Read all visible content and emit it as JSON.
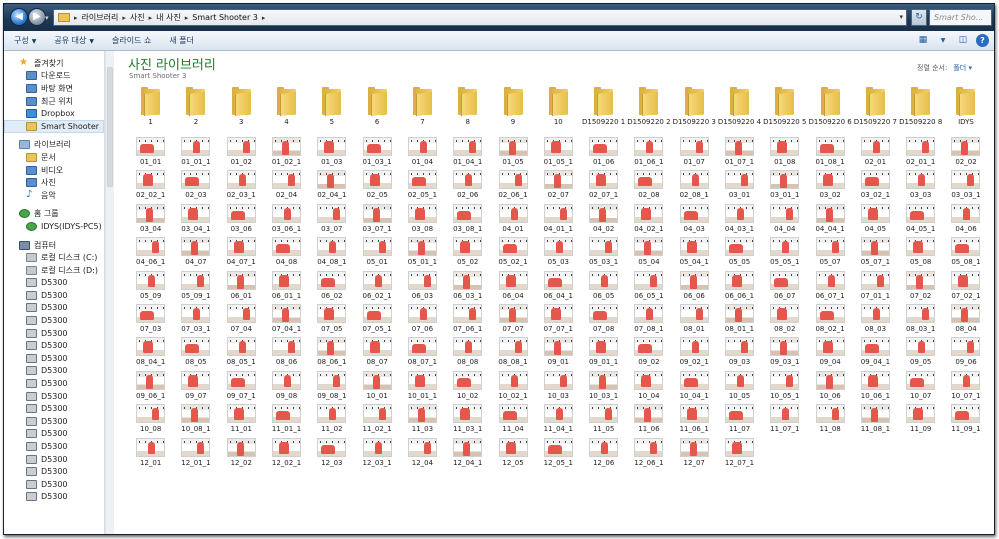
{
  "window": {
    "breadcrumb": [
      "라이브러리",
      "사진",
      "내 사진",
      "Smart Shooter 3"
    ],
    "search_placeholder": "Smart Sho..."
  },
  "toolbar": {
    "items": [
      "구성",
      "공유 대상",
      "슬라이드 쇼",
      "새 폴더"
    ]
  },
  "sidebar": {
    "groups": [
      {
        "head": "즐겨찾기",
        "icon": "star-icon",
        "items": [
          {
            "label": "다운로드",
            "icon": "download-folder-icon"
          },
          {
            "label": "바탕 화면",
            "icon": "desktop-icon"
          },
          {
            "label": "최근 위치",
            "icon": "recent-places-icon"
          },
          {
            "label": "Dropbox",
            "icon": "dropbox-icon"
          },
          {
            "label": "Smart Shooter",
            "icon": "folder-icon",
            "selected": true
          }
        ]
      },
      {
        "head": "라이브러리",
        "icon": "library-icon",
        "items": [
          {
            "label": "문서",
            "icon": "documents-icon"
          },
          {
            "label": "비디오",
            "icon": "video-icon"
          },
          {
            "label": "사진",
            "icon": "pictures-icon"
          },
          {
            "label": "음악",
            "icon": "music-icon"
          }
        ]
      },
      {
        "head": "홈 그룹",
        "icon": "homegroup-icon",
        "items": [
          {
            "label": "IDYS(IDYS-PC5)",
            "icon": "user-icon"
          }
        ]
      },
      {
        "head": "컴퓨터",
        "icon": "computer-icon",
        "items": [
          {
            "label": "로컬 디스크 (C:)",
            "icon": "drive-icon"
          },
          {
            "label": "로컬 디스크 (D:)",
            "icon": "drive-icon"
          },
          {
            "label": "D5300",
            "icon": "camera-device-icon"
          },
          {
            "label": "D5300",
            "icon": "camera-device-icon"
          },
          {
            "label": "D5300",
            "icon": "camera-device-icon"
          },
          {
            "label": "D5300",
            "icon": "camera-device-icon"
          },
          {
            "label": "D5300",
            "icon": "camera-device-icon"
          },
          {
            "label": "D5300",
            "icon": "camera-device-icon"
          },
          {
            "label": "D5300",
            "icon": "camera-device-icon"
          },
          {
            "label": "D5300",
            "icon": "camera-device-icon"
          },
          {
            "label": "D5300",
            "icon": "camera-device-icon"
          },
          {
            "label": "D5300",
            "icon": "camera-device-icon"
          },
          {
            "label": "D5300",
            "icon": "camera-device-icon"
          },
          {
            "label": "D5300",
            "icon": "camera-device-icon"
          },
          {
            "label": "D5300",
            "icon": "camera-device-icon"
          },
          {
            "label": "D5300",
            "icon": "camera-device-icon"
          },
          {
            "label": "D5300",
            "icon": "camera-device-icon"
          },
          {
            "label": "D5300",
            "icon": "camera-device-icon"
          },
          {
            "label": "D5300",
            "icon": "camera-device-icon"
          },
          {
            "label": "D5300",
            "icon": "camera-device-icon"
          }
        ]
      }
    ]
  },
  "library": {
    "title": "사진 라이브러리",
    "subtitle": "Smart Shooter 3",
    "arrange_label": "정렬 순서:",
    "arrange_value": "폴더"
  },
  "folders": [
    "1",
    "2",
    "3",
    "4",
    "5",
    "6",
    "7",
    "8",
    "9",
    "10",
    "D1509220 1",
    "D1509220 2",
    "D1509220 3",
    "D1509220 4",
    "D1509220 5",
    "D1509220 6",
    "D1509220 7",
    "D1509220 8",
    "IDYS"
  ],
  "photos": [
    "01_01",
    "01_01_1",
    "01_02",
    "01_02_1",
    "01_03",
    "01_03_1",
    "01_04",
    "01_04_1",
    "01_05",
    "01_05_1",
    "01_06",
    "01_06_1",
    "01_07",
    "01_07_1",
    "01_08",
    "01_08_1",
    "02_01",
    "02_01_1",
    "02_02",
    "02_02_1",
    "02_03",
    "02_03_1",
    "02_04",
    "02_04_1",
    "02_05",
    "02_05_1",
    "02_06",
    "02_06_1",
    "02_07",
    "02_07_1",
    "02_08",
    "02_08_1",
    "03_01",
    "03_01_1",
    "03_02",
    "03_02_1",
    "03_03",
    "03_03_1",
    "03_04",
    "03_04_1",
    "03_06",
    "03_06_1",
    "03_07",
    "03_07_1",
    "03_08",
    "03_08_1",
    "04_01",
    "04_01_1",
    "04_02",
    "04_02_1",
    "04_03",
    "04_03_1",
    "04_04",
    "04_04_1",
    "04_05",
    "04_05_1",
    "04_06",
    "04_06_1",
    "04_07",
    "04_07_1",
    "04_08",
    "04_08_1",
    "05_01",
    "05_01_1",
    "05_02",
    "05_02_1",
    "05_03",
    "05_03_1",
    "05_04",
    "05_04_1",
    "05_05",
    "05_05_1",
    "05_07",
    "05_07_1",
    "05_08",
    "05_08_1",
    "05_09",
    "05_09_1",
    "06_01",
    "06_01_1",
    "06_02",
    "06_02_1",
    "06_03",
    "06_03_1",
    "06_04",
    "06_04_1",
    "06_05",
    "06_05_1",
    "06_06",
    "06_06_1",
    "06_07",
    "06_07_1",
    "07_01_1",
    "07_02",
    "07_02_1",
    "07_03",
    "07_03_1",
    "07_04",
    "07_04_1",
    "07_05",
    "07_05_1",
    "07_06",
    "07_06_1",
    "07_07",
    "07_07_1",
    "07_08",
    "07_08_1",
    "08_01",
    "08_01_1",
    "08_02",
    "08_02_1",
    "08_03",
    "08_03_1",
    "08_04",
    "08_04_1",
    "08_05",
    "08_05_1",
    "08_06",
    "08_06_1",
    "08_07",
    "08_07_1",
    "08_08",
    "08_08_1",
    "09_01",
    "09_01_1",
    "09_02",
    "09_02_1",
    "09_03",
    "09_03_1",
    "09_04",
    "09_04_1",
    "09_05",
    "09_06",
    "09_06_1",
    "09_07",
    "09_07_1",
    "09_08",
    "09_08_1",
    "10_01",
    "10_01_1",
    "10_02",
    "10_02_1",
    "10_03",
    "10_03_1",
    "10_04",
    "10_04_1",
    "10_05",
    "10_05_1",
    "10_06",
    "10_06_1",
    "10_07",
    "10_07_1",
    "10_08",
    "10_08_1",
    "11_01",
    "11_01_1",
    "11_02",
    "11_02_1",
    "11_03",
    "11_03_1",
    "11_04",
    "11_04_1",
    "11_05",
    "11_06",
    "11_06_1",
    "11_07",
    "11_07_1",
    "11_08",
    "11_08_1",
    "11_09",
    "11_09_1",
    "12_01",
    "12_01_1",
    "12_02",
    "12_02_1",
    "12_03",
    "12_03_1",
    "12_04",
    "12_04_1",
    "12_05",
    "12_05_1",
    "12_06",
    "12_06_1",
    "12_07",
    "12_07_1"
  ]
}
